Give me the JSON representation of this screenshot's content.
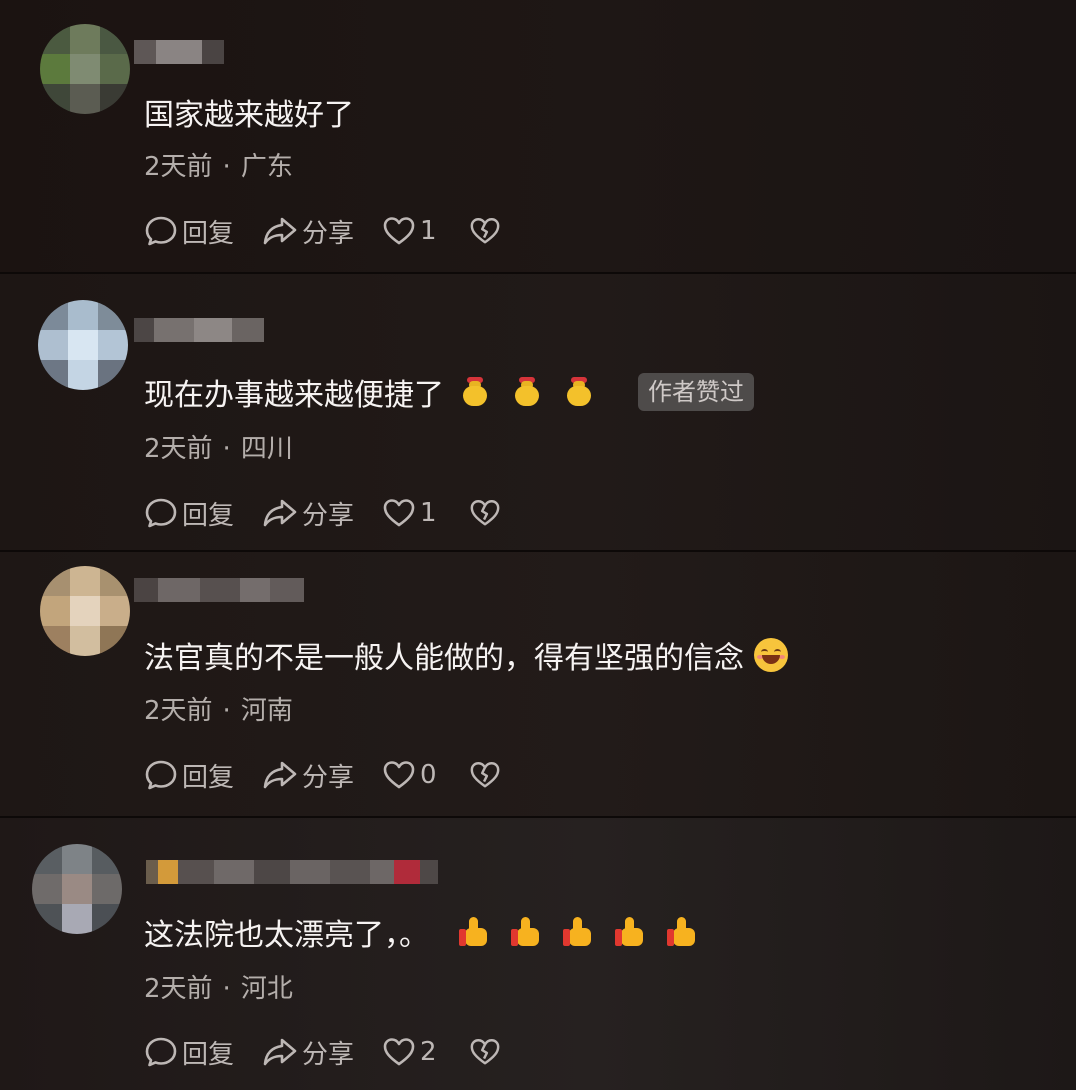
{
  "labels": {
    "reply": "回复",
    "share": "分享",
    "separator": "·"
  },
  "comments": [
    {
      "text": "国家越来越好了",
      "time": "2天前",
      "location": "广东",
      "likes": "1",
      "emojis": [],
      "tag": null
    },
    {
      "text": "现在办事越来越便捷了",
      "time": "2天前",
      "location": "四川",
      "likes": "1",
      "emojis": [
        "money-bag-emoji",
        "money-bag-emoji",
        "money-bag-emoji"
      ],
      "tag": "作者赞过"
    },
    {
      "text": "法官真的不是一般人能做的，得有坚强的信念",
      "time": "2天前",
      "location": "河南",
      "likes": "0",
      "emojis": [
        "smile-emoji"
      ],
      "tag": null
    },
    {
      "text": "这法院也太漂亮了，。",
      "time": "2天前",
      "location": "河北",
      "likes": "2",
      "emojis": [
        "thumbs-up-emoji",
        "thumbs-up-emoji",
        "thumbs-up-emoji",
        "thumbs-up-emoji",
        "thumbs-up-emoji"
      ],
      "tag": null
    }
  ]
}
